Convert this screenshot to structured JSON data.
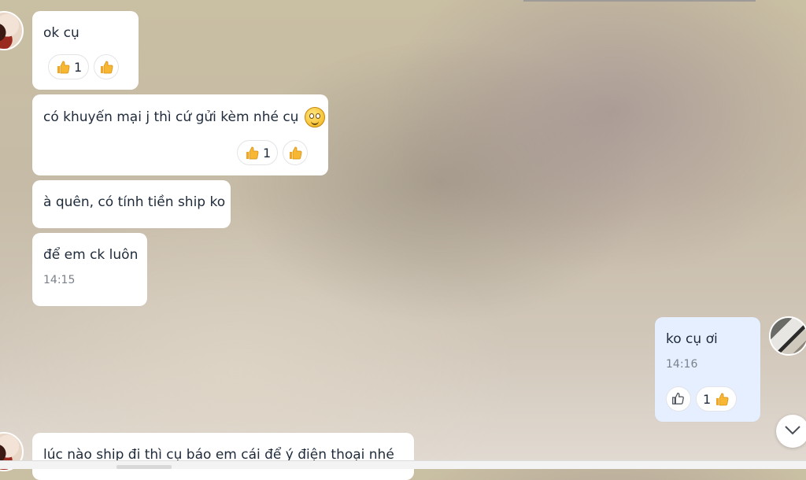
{
  "messages": [
    {
      "text": "ok cụ",
      "reactions": {
        "count": "1",
        "count_emoji": "thumbs-up",
        "add_emoji": "thumbs-up"
      }
    },
    {
      "text": "có khuyến mại j thì cứ gửi kèm nhé cụ",
      "emoji": "smiling-face",
      "reactions": {
        "count": "1",
        "count_emoji": "thumbs-up",
        "add_emoji": "thumbs-up"
      }
    },
    {
      "text": "à quên, có tính tiền ship ko"
    },
    {
      "text": "để em ck luôn",
      "time": "14:15"
    },
    {
      "text": "ko cụ ơi",
      "time": "14:16",
      "mine": true,
      "reactions": {
        "like_icon": "thumbs-up-outline",
        "count": "1",
        "count_emoji": "thumbs-up"
      }
    },
    {
      "text": "lúc nào ship đi thì cụ báo em cái để ý điện thoại nhé"
    }
  ],
  "colors": {
    "bubble_incoming": "#ffffff",
    "bubble_outgoing": "#e5efff",
    "text": "#1e2a3a",
    "time": "#7a818a",
    "thumb": "#f7b733"
  },
  "icons": {
    "scroll_down": "chevron-down-icon"
  }
}
